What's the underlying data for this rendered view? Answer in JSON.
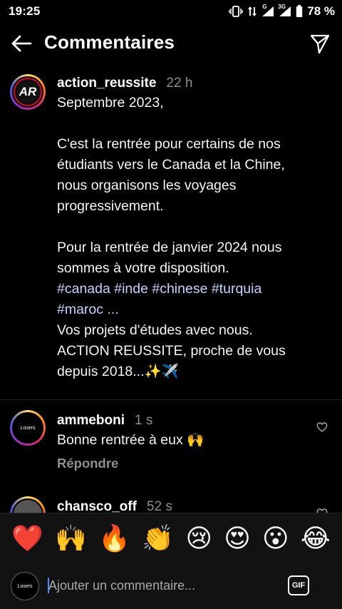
{
  "status_bar": {
    "time": "19:25",
    "battery_percent": "78 %",
    "network_labels": [
      "G",
      "3G"
    ],
    "icons": [
      "vibrate-icon",
      "data-arrows-icon",
      "signal-icon",
      "signal-icon",
      "battery-icon"
    ]
  },
  "header": {
    "title": "Commentaires",
    "back_icon": "back-arrow-icon",
    "share_icon": "send-icon"
  },
  "post": {
    "author": "action_reussite",
    "time_ago": "22 h",
    "avatar_initials": "AR",
    "lines": [
      "Septembre 2023,",
      "",
      "C'est la rentrée pour certains de nos",
      "étudiants vers le Canada et la Chine,",
      "nous organisons les voyages",
      "progressivement.",
      "",
      "Pour la rentrée de janvier 2024 nous",
      "sommes à votre disposition."
    ],
    "hashtags_line1": "#canada #inde #chinese #turquia",
    "hashtags_line2": "#maroc ...",
    "lines_after": [
      "Vos projets d'études avec nous.",
      "ACTION REUSSITE, proche de vous",
      "depuis 2018...✨✈️"
    ]
  },
  "comments": [
    {
      "username": "ammeboni",
      "time_ago": "1 s",
      "text": "Bonne rentrée à eux 🙌",
      "reply_label": "Répondre",
      "avatar_label": "Losers"
    },
    {
      "username": "chansco_off",
      "time_ago": "52 s"
    }
  ],
  "emoji_bar": [
    "❤️",
    "🙌",
    "🔥",
    "👏",
    "😢",
    "😍",
    "😮",
    "😂"
  ],
  "composer": {
    "placeholder": "Ajouter un commentaire...",
    "gif_label": "GIF",
    "avatar_label": "Losers"
  }
}
